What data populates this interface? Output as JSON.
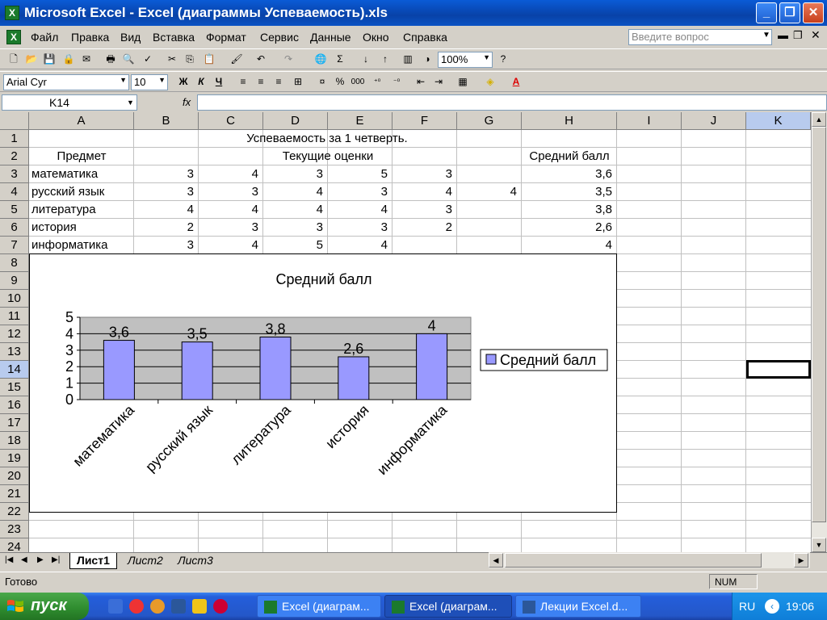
{
  "window": {
    "title": "Microsoft Excel - Excel (диаграммы Успеваемость).xls",
    "app_icon": "X",
    "buttons": {
      "minimize": "_",
      "maximize": "❐",
      "close": "✕"
    }
  },
  "menu": {
    "items": [
      "Файл",
      "Правка",
      "Вид",
      "Вставка",
      "Формат",
      "Сервис",
      "Данные",
      "Окно",
      "Справка"
    ],
    "help_placeholder": "Введите вопрос"
  },
  "toolbar": {
    "zoom": "100%",
    "font_name": "Arial Cyr",
    "font_size": "10",
    "bold": "Ж",
    "italic": "К",
    "underline": "Ч",
    "percent": "%",
    "thousands": "000"
  },
  "formula_bar": {
    "name_box": "K14",
    "fx": "fx",
    "value": ""
  },
  "columns": [
    "A",
    "B",
    "C",
    "D",
    "E",
    "F",
    "G",
    "H",
    "I",
    "J",
    "K"
  ],
  "rows": [
    "1",
    "2",
    "3",
    "4",
    "5",
    "6",
    "7",
    "8",
    "9",
    "10",
    "11",
    "12",
    "13",
    "14",
    "15",
    "16",
    "17",
    "18",
    "19",
    "20",
    "21",
    "22",
    "23",
    "24"
  ],
  "sheet": {
    "title": "Успеваемость за 1 четверть.",
    "header_subject": "Предмет",
    "header_grades": "Текущие оценки",
    "header_average": "Средний балл",
    "data_rows": [
      {
        "subject": "математика",
        "grades": [
          "3",
          "4",
          "3",
          "5",
          "3",
          ""
        ],
        "avg": "3,6"
      },
      {
        "subject": "русский язык",
        "grades": [
          "3",
          "3",
          "4",
          "3",
          "4",
          "4"
        ],
        "avg": "3,5"
      },
      {
        "subject": "литература",
        "grades": [
          "4",
          "4",
          "4",
          "4",
          "3",
          ""
        ],
        "avg": "3,8"
      },
      {
        "subject": "история",
        "grades": [
          "2",
          "3",
          "3",
          "3",
          "2",
          ""
        ],
        "avg": "2,6"
      },
      {
        "subject": "информатика",
        "grades": [
          "3",
          "4",
          "5",
          "4",
          "",
          ""
        ],
        "avg": "4"
      }
    ]
  },
  "chart_data": {
    "type": "bar",
    "title": "Средний балл",
    "categories": [
      "математика",
      "русский язык",
      "литература",
      "история",
      "информатика"
    ],
    "series": [
      {
        "name": "Средний балл",
        "values": [
          3.6,
          3.5,
          3.8,
          2.6,
          4
        ],
        "labels": [
          "3,6",
          "3,5",
          "3,8",
          "2,6",
          "4"
        ]
      }
    ],
    "ylim": [
      0,
      5
    ],
    "yticks": [
      "0",
      "1",
      "2",
      "3",
      "4",
      "5"
    ],
    "grid": true,
    "legend": "right",
    "colors": {
      "bar": "#9999ff",
      "plot_bg": "#c0c0c0"
    }
  },
  "sheet_tabs": [
    "Лист1",
    "Лист2",
    "Лист3"
  ],
  "status": {
    "left": "Готово",
    "right": "NUM"
  },
  "taskbar": {
    "start": "пуск",
    "tasks": [
      "Excel (диаграм...",
      "Excel (диаграм...",
      "Лекции Excel.d..."
    ],
    "lang": "RU",
    "clock": "19:06"
  }
}
